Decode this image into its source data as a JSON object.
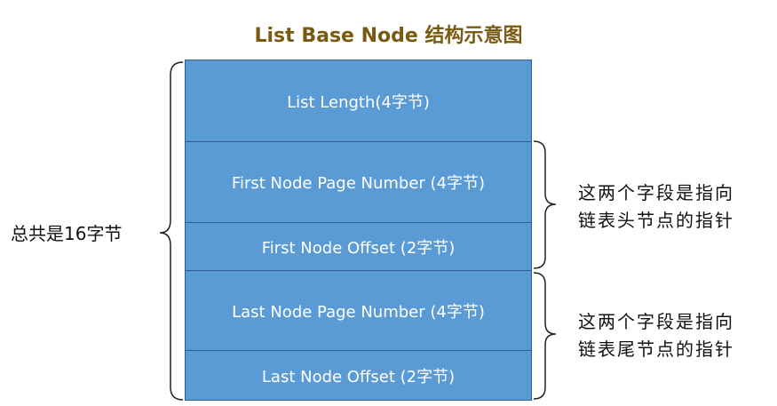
{
  "title": "List Base Node 结构示意图",
  "fields": [
    "List Length(4字节)",
    "First Node Page Number (4字节)",
    "First Node Offset (2字节)",
    "Last Node Page Number (4字节)",
    "Last Node Offset (2字节)"
  ],
  "total_label": "总共是16字节",
  "first_note": {
    "line1": "这两个字段是指向",
    "line2": "链表头节点的指针"
  },
  "last_note": {
    "line1": "这两个字段是指向",
    "line2": "链表尾节点的指针"
  }
}
